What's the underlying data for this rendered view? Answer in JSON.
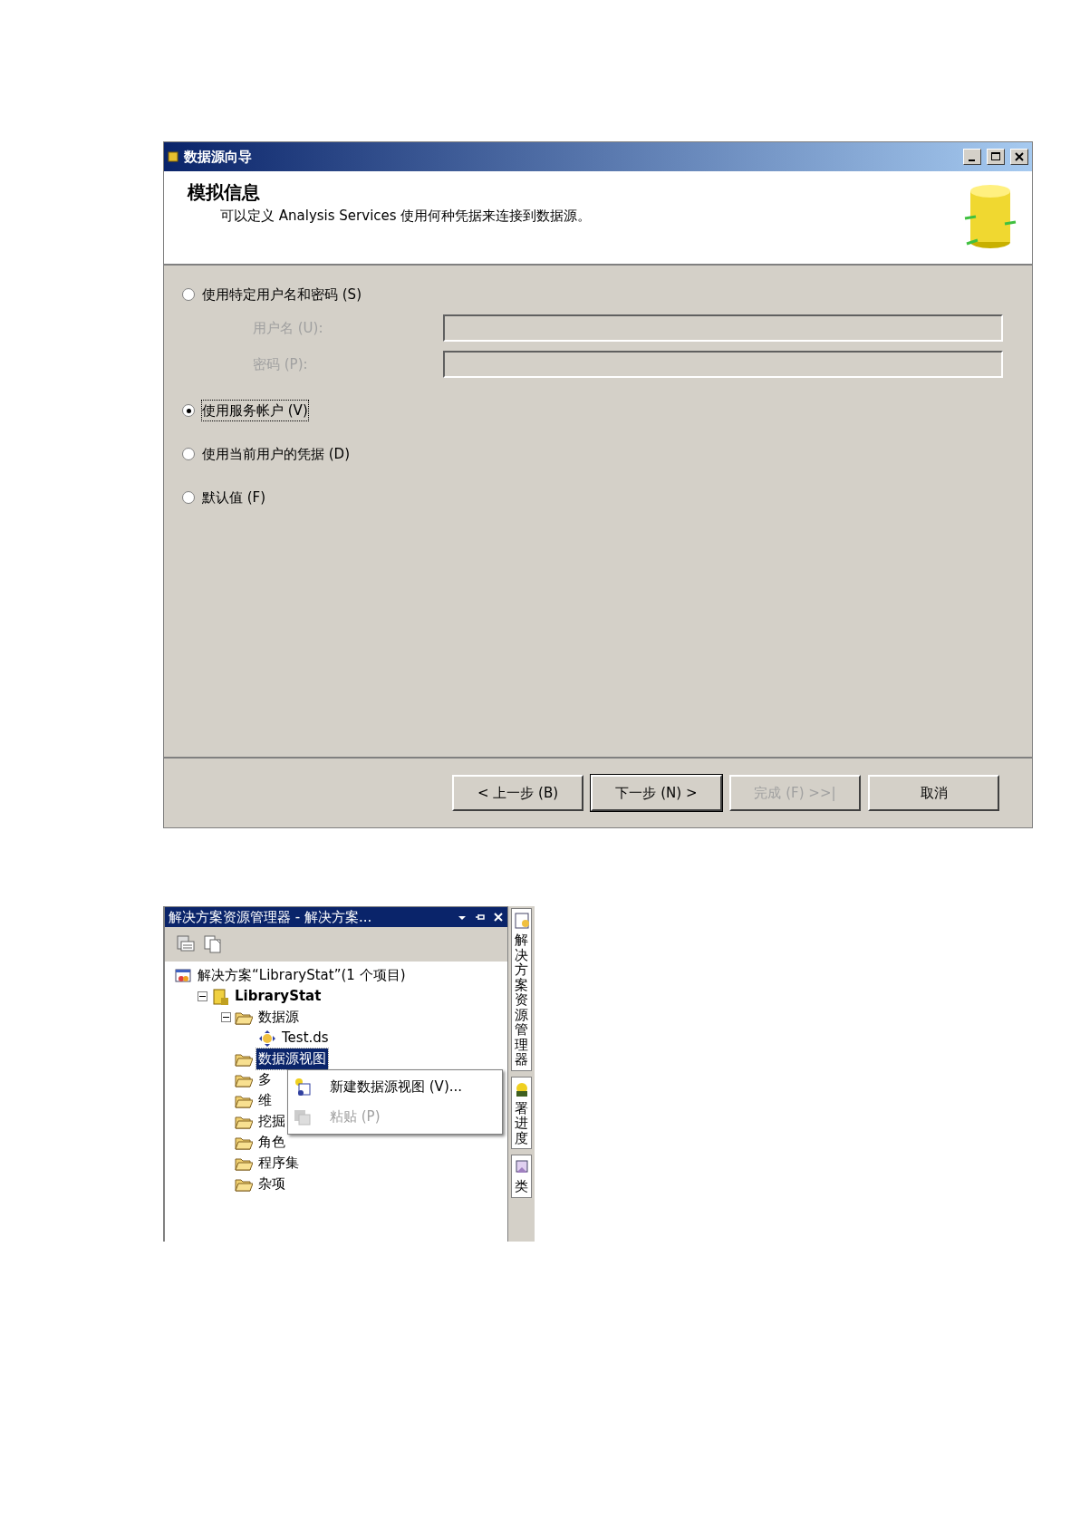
{
  "wizard": {
    "title": "数据源向导",
    "header": {
      "title": "模拟信息",
      "description": "可以定义 Analysis Services 使用何种凭据来连接到数据源。"
    },
    "options": [
      {
        "label": "使用特定用户名和密码 (S)",
        "selected": false,
        "focused": false,
        "fields": [
          {
            "label": "用户名 (U):",
            "disabled": true
          },
          {
            "label": "密码 (P):",
            "disabled": true
          }
        ]
      },
      {
        "label": "使用服务帐户 (V)",
        "selected": true,
        "focused": true
      },
      {
        "label": "使用当前用户的凭据 (D)",
        "selected": false,
        "focused": false
      },
      {
        "label": "默认值 (F)",
        "selected": false,
        "focused": false
      }
    ],
    "buttons": [
      {
        "label": "< 上一步 (B)",
        "disabled": false,
        "default": false
      },
      {
        "label": "下一步 (N) >",
        "disabled": false,
        "default": true
      },
      {
        "label": "完成 (F) >>|",
        "disabled": true,
        "default": false
      },
      {
        "label": "取消",
        "disabled": false,
        "default": false
      }
    ]
  },
  "explorer": {
    "title": "解决方案资源管理器 - 解决方案...",
    "tree": [
      {
        "label": "解决方案“LibraryStat”(1 个项目)",
        "kind": "solution",
        "selected": false,
        "children": [
          {
            "label": "LibraryStat",
            "kind": "project",
            "selected": false,
            "expanded": true,
            "children": [
              {
                "label": "数据源",
                "kind": "folder",
                "selected": false,
                "expanded": true,
                "children": [
                  {
                    "label": "Test.ds",
                    "kind": "datasource",
                    "selected": false
                  }
                ]
              },
              {
                "label": "数据源视图",
                "kind": "folder",
                "selected": true
              },
              {
                "label": "多",
                "kind": "folder",
                "selected": false
              },
              {
                "label": "维",
                "kind": "folder",
                "selected": false
              },
              {
                "label": "挖掘",
                "kind": "folder",
                "selected": false
              },
              {
                "label": "角色",
                "kind": "folder",
                "selected": false
              },
              {
                "label": "程序集",
                "kind": "folder",
                "selected": false
              },
              {
                "label": "杂项",
                "kind": "folder",
                "selected": false
              }
            ]
          }
        ]
      }
    ],
    "context_menu": [
      {
        "label": "新建数据源视图 (V)...",
        "disabled": false
      },
      {
        "label": "粘贴 (P)",
        "disabled": true
      }
    ],
    "side_tabs": [
      {
        "label": "解决方案资源管理器"
      },
      {
        "label": "署进度"
      },
      {
        "label": "类"
      }
    ]
  }
}
